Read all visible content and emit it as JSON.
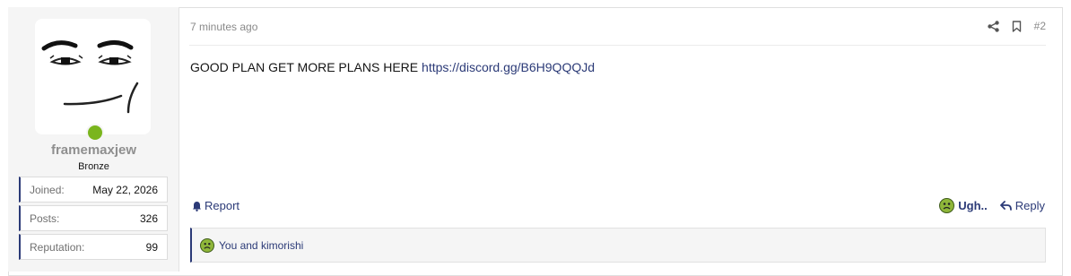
{
  "user": {
    "username": "framemaxjew",
    "title": "Bronze",
    "online": true,
    "stats": [
      {
        "label": "Joined:",
        "value": "May 22, 2026"
      },
      {
        "label": "Posts:",
        "value": "326"
      },
      {
        "label": "Reputation:",
        "value": "99"
      }
    ]
  },
  "post": {
    "time": "7 minutes ago",
    "number": "#2",
    "text": "GOOD PLAN GET MORE PLANS HERE",
    "link": "https://discord.gg/B6H9QQQJd"
  },
  "footer": {
    "report_label": "Report",
    "reaction_label": "Ugh..",
    "reply_label": "Reply"
  },
  "reactions": {
    "summary": "You and kimorishi"
  },
  "colors": {
    "accent": "#2b3a77",
    "online": "#7ab51d",
    "reaction": "#8fb73a"
  }
}
